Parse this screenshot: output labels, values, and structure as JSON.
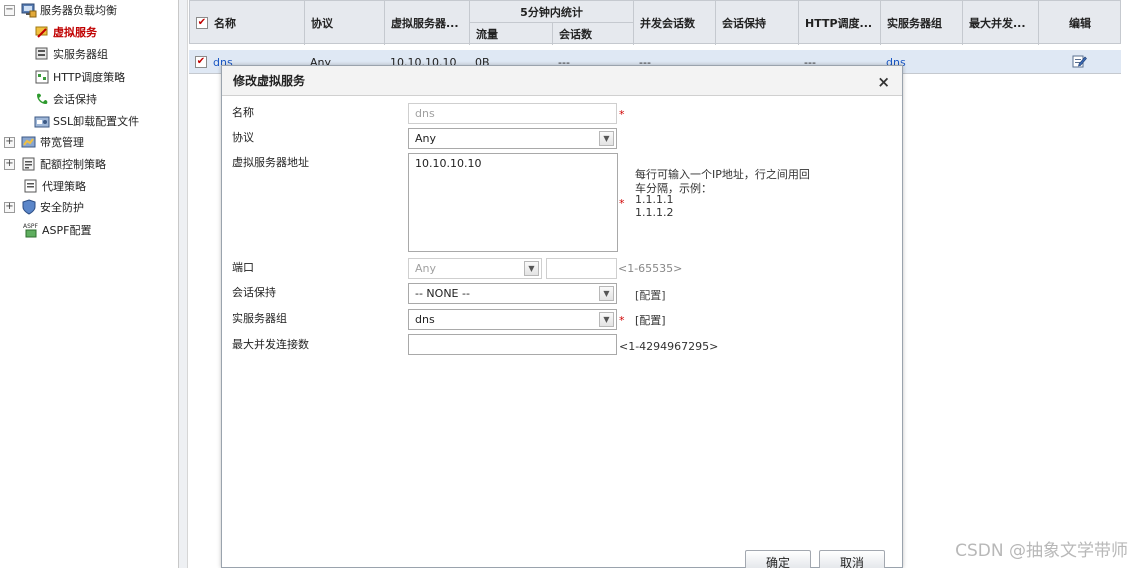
{
  "sidebar": {
    "items": [
      {
        "label": "服务器负载均衡",
        "expander": "−",
        "icon": "server-lb-icon"
      },
      {
        "label": "虚拟服务",
        "icon": "virtual-service-icon"
      },
      {
        "label": "实服务器组",
        "icon": "real-server-group-icon"
      },
      {
        "label": "HTTP调度策略",
        "icon": "http-policy-icon"
      },
      {
        "label": "会话保持",
        "icon": "session-persist-icon"
      },
      {
        "label": "SSL卸载配置文件",
        "icon": "ssl-icon"
      },
      {
        "label": "带宽管理",
        "expander": "+",
        "icon": "bandwidth-icon"
      },
      {
        "label": "配额控制策略",
        "expander": "+",
        "icon": "quota-icon"
      },
      {
        "label": "代理策略",
        "icon": "proxy-icon"
      },
      {
        "label": "安全防护",
        "expander": "+",
        "icon": "shield-icon"
      },
      {
        "label": "ASPF配置",
        "icon": "aspf-icon"
      }
    ]
  },
  "grid": {
    "headers": {
      "name": "名称",
      "protocol": "协议",
      "vs_address": "虚拟服务器...",
      "stats_group": "5分钟内统计",
      "traffic": "流量",
      "sessions": "会话数",
      "concurrent": "并发会话数",
      "persistence": "会话保持",
      "http_policy": "HTTP调度...",
      "server_group": "实服务器组",
      "max_concurrent": "最大并发...",
      "edit": "编辑"
    },
    "row": {
      "name": "dns",
      "protocol": "Any",
      "vs_address": "10.10.10.10",
      "traffic": "0B",
      "sessions": "---",
      "concurrent": "---",
      "http_policy": "---",
      "server_group": "dns"
    },
    "check_mark": "✔",
    "edit_icon": "edit-icon"
  },
  "dialog": {
    "title": "修改虚拟服务",
    "close": "×",
    "required_mark": "*",
    "labels": {
      "name": "名称",
      "protocol": "协议",
      "vs_address": "虚拟服务器地址",
      "port": "端口",
      "persistence": "会话保持",
      "server_group": "实服务器组",
      "max_conn": "最大并发连接数"
    },
    "values": {
      "name": "dns",
      "protocol": "Any",
      "vs_address": "10.10.10.10",
      "port_select": "Any",
      "port_value": "",
      "persistence": "-- NONE --",
      "server_group": "dns",
      "max_conn": ""
    },
    "hints": {
      "address_line1": "每行可输入一个IP地址，行之间用回",
      "address_line2": "车分隔，示例：",
      "address_ex1": "1.1.1.1",
      "address_ex2": "1.1.1.2",
      "port_range": "<1-65535>",
      "config_persistence": "[配置]",
      "config_server_group": "[配置]",
      "max_conn_range": "<1-4294967295>"
    },
    "buttons": {
      "ok": "确定",
      "cancel": "取消"
    }
  },
  "watermark": "CSDN @抽象文学带师"
}
